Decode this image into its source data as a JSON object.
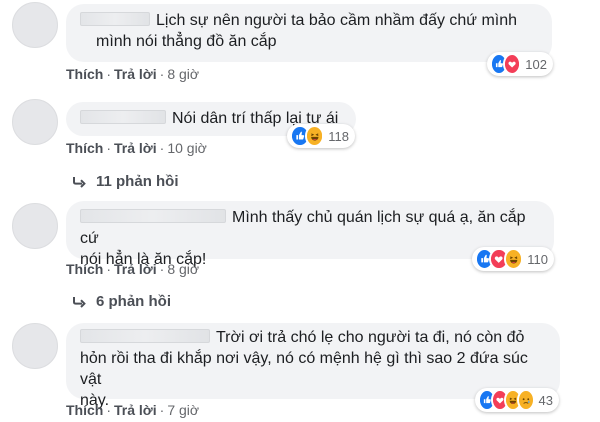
{
  "comments": [
    {
      "text_line1": "Lịch sự nên người ta bảo cầm nhầm đấy chứ mình",
      "text_line2": "mình nói thẳng đồ ăn cắp",
      "like_label": "Thích",
      "reply_label": "Trả lời",
      "time": "8 giờ",
      "reaction_count": "102",
      "reactions": [
        "like",
        "love"
      ]
    },
    {
      "text_line1": "Nói dân trí thấp lại tự ái",
      "like_label": "Thích",
      "reply_label": "Trả lời",
      "time": "10 giờ",
      "reaction_count": "118",
      "reactions": [
        "like",
        "haha"
      ],
      "replies_label": "11 phản hồi"
    },
    {
      "text_line1": "Mình thấy chủ quán lịch sự quá ạ, ăn cắp cứ",
      "text_line2": "nói hẳn là ăn cắp!",
      "like_label": "Thích",
      "reply_label": "Trả lời",
      "time": "8 giờ",
      "reaction_count": "110",
      "reactions": [
        "like",
        "love",
        "haha"
      ],
      "replies_label": "6 phản hồi"
    },
    {
      "text_line1": "Trời ơi trả chó lẹ cho người ta đi, nó còn đỏ",
      "text_line2": "hỏn rồi tha đi khắp nơi vậy, nó có mệnh hệ gì thì sao 2 đứa súc vật",
      "text_line3": "này.",
      "like_label": "Thích",
      "reply_label": "Trả lời",
      "time": "7 giờ",
      "reaction_count": "43",
      "reactions": [
        "like",
        "love",
        "haha",
        "sad"
      ]
    }
  ],
  "colors": {
    "like": "#1877f2",
    "love": "#f33e58",
    "haha": "#f7b125",
    "bubble": "#f2f3f5",
    "meta_text": "#65676b"
  }
}
